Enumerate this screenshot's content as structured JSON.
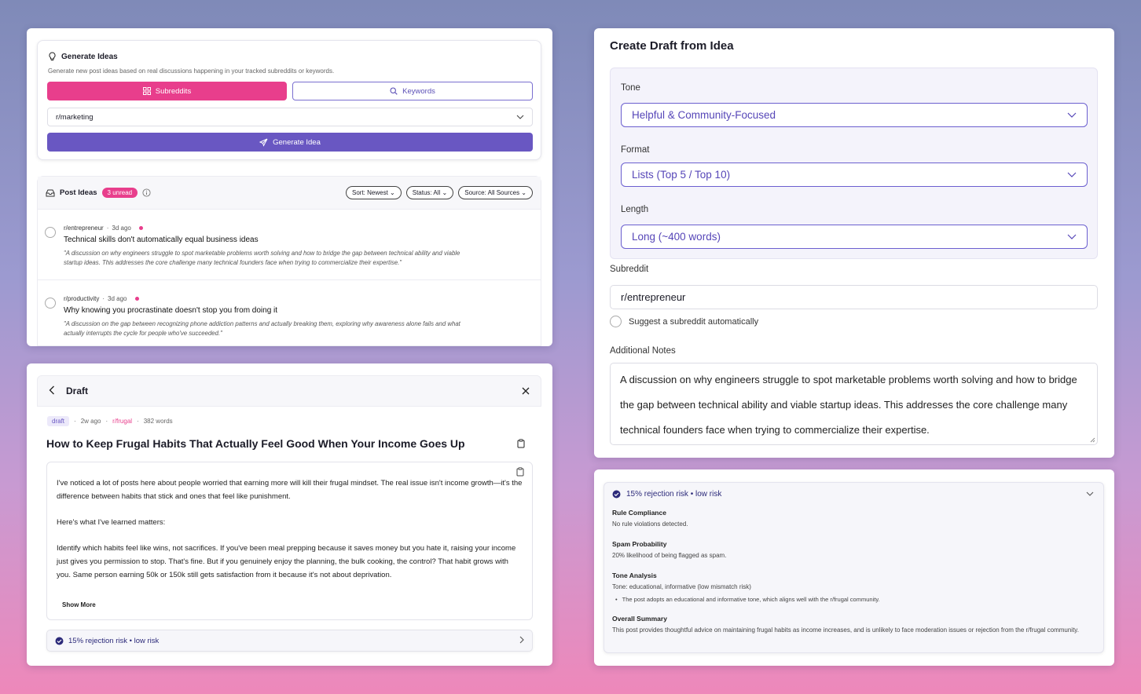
{
  "generate": {
    "title": "Generate Ideas",
    "subtitle": "Generate new post ideas based on real discussions happening in your tracked subreddits or keywords.",
    "subreddits_label": "Subreddits",
    "keywords_label": "Keywords",
    "selected_subreddit": "r/marketing",
    "generate_button": "Generate Idea"
  },
  "ideas": {
    "title": "Post Ideas",
    "unread_badge": "3 unread",
    "sort_label": "Sort: Newest",
    "status_label": "Status: All",
    "source_label": "Source: All Sources",
    "items": [
      {
        "subreddit": "r/entrepreneur",
        "age": "3d ago",
        "title": "Technical skills don't automatically equal business ideas",
        "description": "\"A discussion on why engineers struggle to spot marketable problems worth solving and how to bridge the gap between technical ability and viable startup ideas. This addresses the core challenge many technical founders face when trying to commercialize their expertise.\""
      },
      {
        "subreddit": "r/productivity",
        "age": "3d ago",
        "title": "Why knowing you procrastinate doesn't stop you from doing it",
        "description": "\"A discussion on the gap between recognizing phone addiction patterns and actually breaking them, exploring why awareness alone fails and what actually interrupts the cycle for people who've succeeded.\""
      }
    ]
  },
  "draft": {
    "header": "Draft",
    "status_tag": "draft",
    "age": "2w ago",
    "subreddit": "r/frugal",
    "word_count": "382 words",
    "title": "How to Keep Frugal Habits That Actually Feel Good When Your Income Goes Up",
    "paragraph_1": "I've noticed a lot of posts here about people worried that earning more will kill their frugal mindset. The real issue isn't income growth—it's the difference between habits that stick and ones that feel like punishment.",
    "paragraph_2": "Here's what I've learned matters:",
    "paragraph_3": "Identify which habits feel like wins, not sacrifices. If you've been meal prepping because it saves money but you hate it, raising your income just gives you permission to stop. That's fine. But if you genuinely enjoy the planning, the bulk cooking, the control? That habit grows with you. Same person earning 50k or 150k still gets satisfaction from it because it's not about deprivation.",
    "show_more": "Show More",
    "risk_label": "15% rejection risk • low risk"
  },
  "create_draft": {
    "title": "Create Draft from Idea",
    "tone_label": "Tone",
    "tone_value": "Helpful & Community-Focused",
    "format_label": "Format",
    "format_value": "Lists (Top 5 / Top 10)",
    "length_label": "Length",
    "length_value": "Long (~400 words)",
    "subreddit_label": "Subreddit",
    "subreddit_value": "r/entrepreneur",
    "suggest_label": "Suggest a subreddit automatically",
    "notes_label": "Additional Notes",
    "notes_value": "A discussion on why engineers struggle to spot marketable problems worth solving and how to bridge the gap between technical ability and viable startup ideas. This addresses the core challenge many technical founders face when trying to commercialize their expertise."
  },
  "risk": {
    "header": "15% rejection risk • low risk",
    "rule_title": "Rule Compliance",
    "rule_value": "No rule violations detected.",
    "spam_title": "Spam Probability",
    "spam_value": "20% likelihood of being flagged as spam.",
    "tone_title": "Tone Analysis",
    "tone_value": "Tone: educational, informative (low mismatch risk)",
    "tone_bullet": "The post adopts an educational and informative tone, which aligns well with the r/frugal community.",
    "summary_title": "Overall Summary",
    "summary_value": "This post provides thoughtful advice on maintaining frugal habits as income increases, and is unlikely to face moderation issues or rejection from the r/frugal community."
  },
  "colors": {
    "pink": "#e83e8c",
    "purple": "#6957c2",
    "navy": "#2c2a7a"
  }
}
